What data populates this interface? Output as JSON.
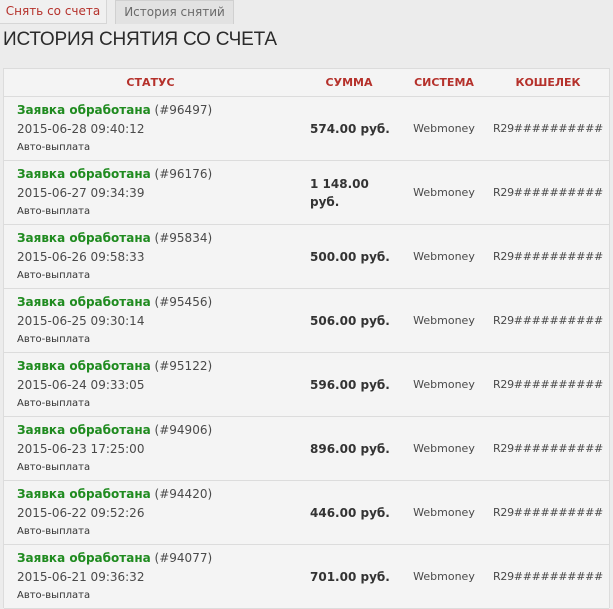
{
  "tabs": {
    "withdraw": "Снять со счета",
    "history": "История снятий"
  },
  "page_title": "ИСТОРИЯ СНЯТИЯ СО СЧЕТА",
  "table": {
    "headers": {
      "status": "СТАТУС",
      "sum": "СУММА",
      "system": "СИСТЕМА",
      "wallet": "КОШЕЛЕК"
    },
    "rows": [
      {
        "status": "Заявка обработана",
        "id": "(#96497)",
        "date": "2015-06-28 09:40:12",
        "mode": "Авто-выплата",
        "sum": "574.00 руб.",
        "system": "Webmoney",
        "wallet": "R29##########"
      },
      {
        "status": "Заявка обработана",
        "id": "(#96176)",
        "date": "2015-06-27 09:34:39",
        "mode": "Авто-выплата",
        "sum": "1 148.00 руб.",
        "system": "Webmoney",
        "wallet": "R29##########"
      },
      {
        "status": "Заявка обработана",
        "id": "(#95834)",
        "date": "2015-06-26 09:58:33",
        "mode": "Авто-выплата",
        "sum": "500.00 руб.",
        "system": "Webmoney",
        "wallet": "R29##########"
      },
      {
        "status": "Заявка обработана",
        "id": "(#95456)",
        "date": "2015-06-25 09:30:14",
        "mode": "Авто-выплата",
        "sum": "506.00 руб.",
        "system": "Webmoney",
        "wallet": "R29##########"
      },
      {
        "status": "Заявка обработана",
        "id": "(#95122)",
        "date": "2015-06-24 09:33:05",
        "mode": "Авто-выплата",
        "sum": "596.00 руб.",
        "system": "Webmoney",
        "wallet": "R29##########"
      },
      {
        "status": "Заявка обработана",
        "id": "(#94906)",
        "date": "2015-06-23 17:25:00",
        "mode": "Авто-выплата",
        "sum": "896.00 руб.",
        "system": "Webmoney",
        "wallet": "R29##########"
      },
      {
        "status": "Заявка обработана",
        "id": "(#94420)",
        "date": "2015-06-22 09:52:26",
        "mode": "Авто-выплата",
        "sum": "446.00 руб.",
        "system": "Webmoney",
        "wallet": "R29##########"
      },
      {
        "status": "Заявка обработана",
        "id": "(#94077)",
        "date": "2015-06-21 09:36:32",
        "mode": "Авто-выплата",
        "sum": "701.00 руб.",
        "system": "Webmoney",
        "wallet": "R29##########"
      }
    ]
  }
}
